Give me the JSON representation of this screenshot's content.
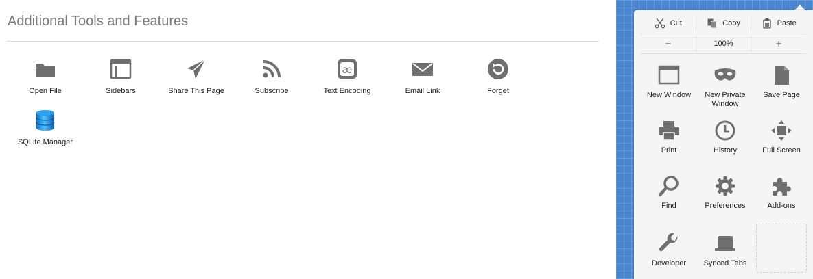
{
  "palette": {
    "title": "Additional Tools and Features",
    "tools": [
      {
        "label": "Open File",
        "icon": "folder-icon"
      },
      {
        "label": "Sidebars",
        "icon": "sidebar-icon"
      },
      {
        "label": "Share This Page",
        "icon": "share-icon"
      },
      {
        "label": "Subscribe",
        "icon": "rss-icon"
      },
      {
        "label": "Text Encoding",
        "icon": "text-encoding-icon"
      },
      {
        "label": "Email Link",
        "icon": "email-icon"
      },
      {
        "label": "Forget",
        "icon": "forget-icon"
      },
      {
        "label": "SQLite Manager",
        "icon": "database-icon"
      }
    ]
  },
  "panel": {
    "edit": {
      "cut": "Cut",
      "copy": "Copy",
      "paste": "Paste"
    },
    "zoom": {
      "minus": "−",
      "level": "100%",
      "plus": "+"
    },
    "items": [
      {
        "label": "New Window",
        "icon": "window-icon"
      },
      {
        "label": "New Private Window",
        "icon": "mask-icon"
      },
      {
        "label": "Save Page",
        "icon": "page-icon"
      },
      {
        "label": "Print",
        "icon": "printer-icon"
      },
      {
        "label": "History",
        "icon": "clock-icon"
      },
      {
        "label": "Full Screen",
        "icon": "fullscreen-icon"
      },
      {
        "label": "Find",
        "icon": "magnifier-icon"
      },
      {
        "label": "Preferences",
        "icon": "gear-icon"
      },
      {
        "label": "Add-ons",
        "icon": "puzzle-icon"
      },
      {
        "label": "Developer",
        "icon": "wrench-icon"
      },
      {
        "label": "Synced Tabs",
        "icon": "synced-tabs-icon"
      }
    ]
  },
  "colors": {
    "icon": "#6f6f6f",
    "accent": "#4a86cf",
    "database": "#1e8fd9"
  }
}
